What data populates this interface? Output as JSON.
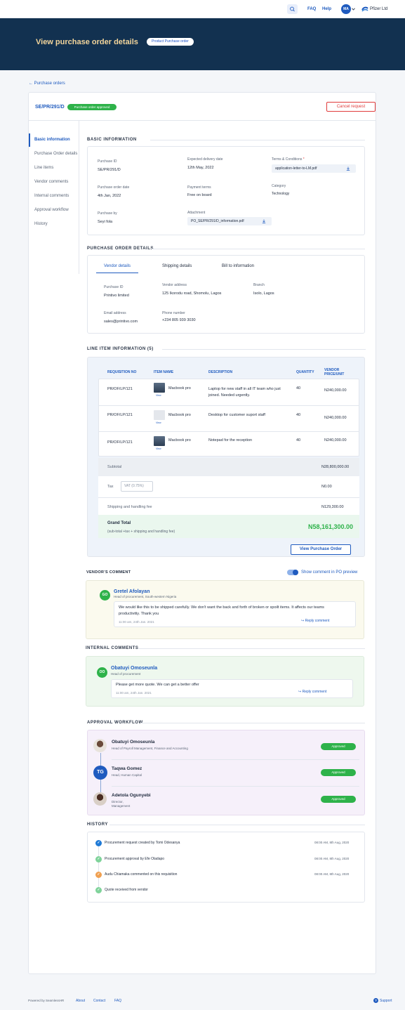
{
  "topbar": {
    "faq": "FAQ",
    "help": "Help",
    "avatar_initials": "MA",
    "company": "Pfizer Ltd"
  },
  "hero": {
    "title": "View purchase order details",
    "badge": "Product Purchase order"
  },
  "breadcrumb": {
    "back_label": "Purchase orders"
  },
  "po": {
    "id": "SE/PR/291/D",
    "status": "Purchase order approved",
    "cancel_label": "Cancel request"
  },
  "side_nav": [
    "Basic information",
    "Purchase Order details",
    "Line items",
    "Vendor comments",
    "Internal comments",
    "Approval workflow",
    "History"
  ],
  "basic": {
    "title": "BASIC  INFORMATION",
    "purchase_id_label": "Purchase ID",
    "purchase_id": "SE/PR/291/D",
    "expected_label": "Expected delivery date",
    "expected": "12th May, 2022",
    "terms_label": "Terms & Conditions",
    "terms_file": "application-letter-to-LM.pdf",
    "order_date_label": "Purchase order date",
    "order_date": "4th Jan, 2022",
    "payment_label": "Payment terms",
    "payment": "Free on board",
    "category_label": "Category",
    "category": "Technology",
    "purchase_by_label": "Purchase by",
    "purchase_by": "Seyi fola",
    "attachment_label": "Attachment",
    "attachment_file": "PO_SE/PR/291/D_information.pdf"
  },
  "po_details": {
    "title": "PURCHASE ORDER DETAILS",
    "tabs": [
      "Vendor details",
      "Shipping details",
      "Bill to information"
    ],
    "purchase_id_label": "Purchase ID",
    "purchase_id": "Printivo limited",
    "vendor_address_label": "Vendor address",
    "vendor_address": "125 Ikorodu road, Shomolu, Lagos",
    "branch_label": "Branch",
    "branch": "Isolo, Lagos",
    "email_label": "Email address",
    "email": "sales@printivo.com",
    "phone_label": "Phone number",
    "phone": "+234 805 939 3030"
  },
  "line_items": {
    "title": "LINE ITEM INFORMATION (5)",
    "headers": [
      "REQUISITION NO",
      "ITEM NAME",
      "DESCRIPTION",
      "QUANTITY",
      "VENDOR PRICE/UNIT"
    ],
    "rows": [
      {
        "req": "PR/OF/LP/121",
        "item": "Macbook pro",
        "view": "View",
        "desc": "Laptop for new staff in all IT team who just joined. Needed urgently.",
        "qty": "40",
        "price": "N240,000.00"
      },
      {
        "req": "PR/OF/LP/121",
        "item": "Macbook pro",
        "view": "View",
        "desc": "Desktop for customer suport staff",
        "qty": "40",
        "price": "N240,000.00"
      },
      {
        "req": "PR/OF/LP/121",
        "item": "Macbook pro",
        "view": "View",
        "desc": "Notepad for the reception",
        "qty": "40",
        "price": "N240,000.00"
      }
    ],
    "subtotal_label": "Subtotal",
    "subtotal": "N28,800,000.00",
    "tax_label": "Tax",
    "vat": "VAT (0.75%)",
    "tax": "N0.00",
    "shipping_label": "Shipping and handling fee",
    "shipping": "N129,300.00",
    "grand_label": "Grand Total",
    "grand_sub": "(sub-total +tax + shipping and handling fee)",
    "grand": "N58,161,300.00",
    "view_po_label": "View Purchase Order"
  },
  "vendor_comment": {
    "title": "VENDOR'S COMMENT",
    "toggle_label": "Show comment in PO preview",
    "initials": "GO",
    "name": "Gretel Afolayan",
    "role": "Head of procurement, South-western Nigeria",
    "text": "We would like this to be shipped carefully. We don't want the back and forth of broken or spoilt items. It affects our teams productivitiy. Thank you",
    "time": "11:00 am, 24th Jan. 2021",
    "reply": "Reply comment"
  },
  "internal_comment": {
    "title": "INTERNAL COMMENTS",
    "initials": "OO",
    "name": "Obatuyi Omoseunla",
    "role": "Head of procurement",
    "text": "Please get more quote. We can get a better offer",
    "time": "11:00 am, 24th Jan. 2021",
    "reply": "Reply comment"
  },
  "approval": {
    "title": "APPROVAL WORKFLOW",
    "items": [
      {
        "name": "Obatuyi Omoseunla",
        "role": "Head of Payroll Management, Finance and Accounting",
        "status": "Approved",
        "initials": ""
      },
      {
        "name": "Taqwa Gomez",
        "role": "Head, Human Capital",
        "status": "Approved",
        "initials": "TG"
      },
      {
        "name": "Adetola Ogunyebi",
        "role": "Director, Management",
        "status": "Approved",
        "initials": ""
      }
    ]
  },
  "history": {
    "title": "HISTORY",
    "items": [
      {
        "text": "Procurement request created by Tomi Odesanya",
        "time": "08:00 AM, 8th Aug, 2020"
      },
      {
        "text": "Procurement approval by Efe Oladapo",
        "time": "08:00 AM, 8th Aug, 2020"
      },
      {
        "text": "Audu Chiamaka commented on this requisition",
        "time": "08:00 AM, 8th Aug, 2020"
      },
      {
        "text": "Quote received from vendor",
        "time": ""
      }
    ]
  },
  "footer": {
    "powered": "Powered by SeamlessHR",
    "about": "About",
    "contact": "Contact",
    "faq": "FAQ",
    "support": "Support"
  },
  "colors": {
    "navy": "#123150",
    "accent": "#1f5bbf",
    "success": "#2eb24a",
    "danger": "#e03b3b",
    "gold": "#f3d59b"
  }
}
